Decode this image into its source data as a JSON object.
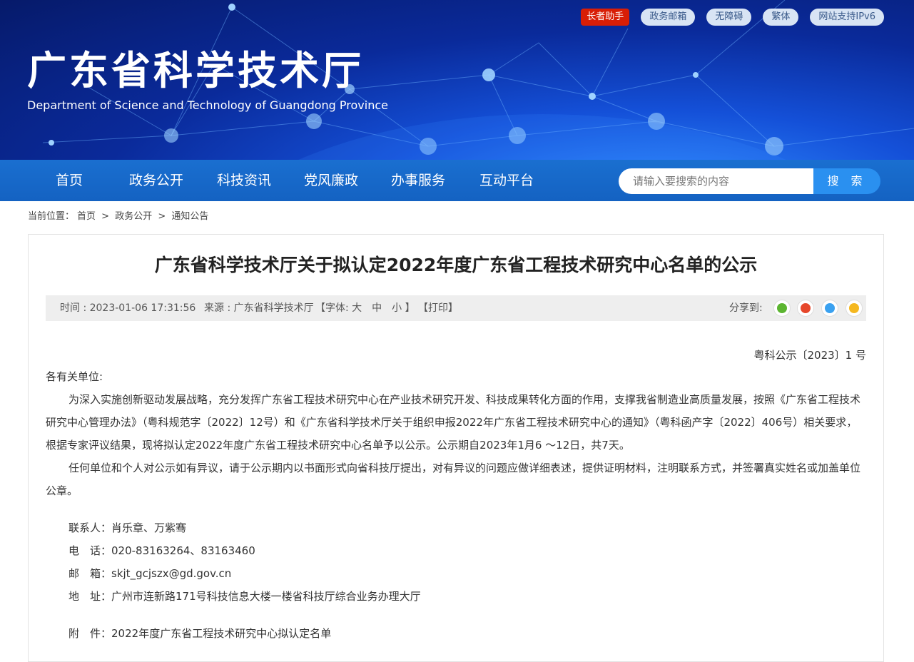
{
  "header": {
    "title": "广东省科学技术厅",
    "subtitle": "Department of Science and Technology of Guangdong Province",
    "top_links": [
      "长者助手",
      "政务邮箱",
      "无障碍",
      "繁体",
      "网站支持IPv6"
    ]
  },
  "nav": {
    "items": [
      "首页",
      "政务公开",
      "科技资讯",
      "党风廉政",
      "办事服务",
      "互动平台"
    ],
    "search_placeholder": "请输入要搜索的内容",
    "search_button": "搜 索"
  },
  "breadcrumb": {
    "prefix": "当前位置：",
    "items": [
      "首页",
      "政务公开",
      "通知公告"
    ],
    "sep": ">"
  },
  "article": {
    "title": "广东省科学技术厅关于拟认定2022年度广东省工程技术研究中心名单的公示",
    "time": "时间 : 2023-01-06 17:31:56",
    "source": "来源 : 广东省科学技术厅",
    "font_label": "【字体: 大　中　小 】",
    "print_label": "【打印】",
    "share_label": "分享到:",
    "share_icons": [
      "wechat-icon",
      "weibo-icon",
      "qq-icon",
      "qzone-icon"
    ],
    "doc_number": "粤科公示〔2023〕1 号",
    "salutation": "各有关单位:",
    "paragraph1": "为深入实施创新驱动发展战略，充分发挥广东省工程技术研究中心在产业技术研究开发、科技成果转化方面的作用，支撑我省制造业高质量发展，按照《广东省工程技术研究中心管理办法》（粤科规范字〔2022〕12号）和《广东省科学技术厅关于组织申报2022年广东省工程技术研究中心的通知》（粤科函产字〔2022〕406号）相关要求，根据专家评议结果，现将拟认定2022年度广东省工程技术研究中心名单予以公示。公示期自2023年1月6 ～12日，共7天。",
    "paragraph2": "任何单位和个人对公示如有异议，请于公示期内以书面形式向省科技厅提出，对有异议的问题应做详细表述，提供证明材料，注明联系方式，并签署真实姓名或加盖单位公章。",
    "contact_label": "联系人：",
    "contact_value": "肖乐章、万紫骞",
    "phone_label": "电　话：",
    "phone_value": "020-83163264、83163460",
    "email_label": "邮　箱：",
    "email_value": "skjt_gcjszx@gd.gov.cn",
    "address_label": "地　址：",
    "address_value": "广州市连新路171号科技信息大楼一楼省科技厅综合业务办理大厅",
    "attach_label": "附　件：",
    "attach_value": "2022年度广东省工程技术研究中心拟认定名单"
  },
  "colors": {
    "nav": "#1a6fd0",
    "search_button": "#2a90f0",
    "elder": "#d81e06"
  }
}
